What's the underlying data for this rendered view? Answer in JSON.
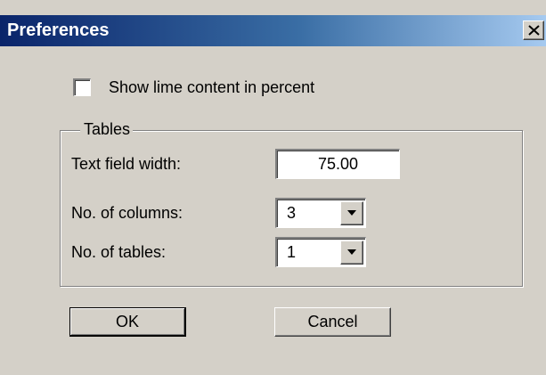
{
  "window": {
    "title": "Preferences",
    "close_glyph": "close-icon"
  },
  "options": {
    "show_lime_label": "Show lime content in percent",
    "show_lime_checked": false
  },
  "tables_group": {
    "title": "Tables",
    "text_field_width": {
      "label": "Text field width:",
      "value": "75.00"
    },
    "columns": {
      "label": "No. of columns:",
      "value": "3"
    },
    "tables": {
      "label": "No. of tables:",
      "value": "1"
    }
  },
  "buttons": {
    "ok_label": "OK",
    "cancel_label": "Cancel"
  },
  "colors": {
    "dialog_face": "#d4d0c8",
    "title_gradient_start": "#0a246a",
    "title_gradient_end": "#a6caf0"
  }
}
